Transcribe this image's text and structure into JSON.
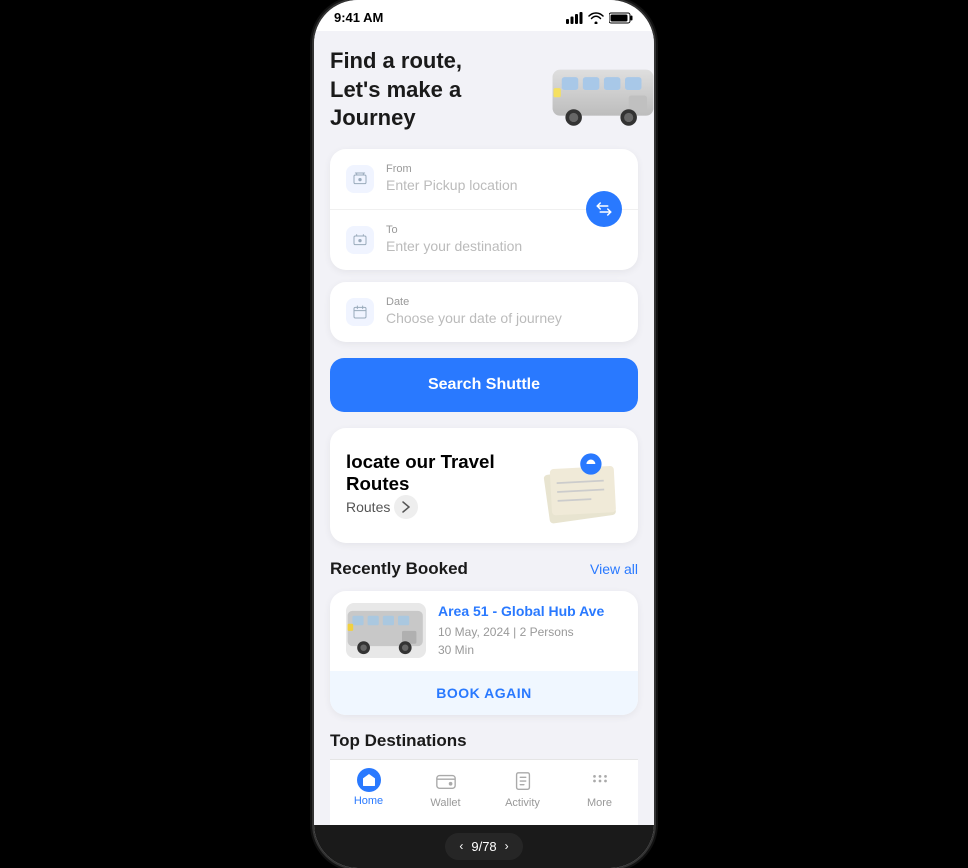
{
  "statusBar": {
    "time": "9:41 AM"
  },
  "hero": {
    "line1": "Find a route,",
    "line2": "Let's make a Journey"
  },
  "form": {
    "fromLabel": "From",
    "fromPlaceholder": "Enter Pickup location",
    "toLabel": "To",
    "toPlaceholder": "Enter your destination",
    "dateLabel": "Date",
    "datePlaceholder": "Choose your date of journey"
  },
  "searchButton": {
    "label": "Search Shuttle"
  },
  "routesCard": {
    "title": "locate our Travel Routes",
    "buttonLabel": "Routes"
  },
  "recentlyBooked": {
    "sectionTitle": "Recently Booked",
    "viewAllLabel": "View all",
    "booking": {
      "route": "Area 51 - Global Hub Ave",
      "date": "10 May, 2024 | 2 Persons",
      "duration": "30 Min"
    },
    "bookAgainLabel": "BOOK AGAIN"
  },
  "topDestinations": {
    "title": "Top Destinations"
  },
  "bottomNav": {
    "items": [
      {
        "label": "Home",
        "icon": "home-icon",
        "active": true
      },
      {
        "label": "Wallet",
        "icon": "wallet-icon",
        "active": false
      },
      {
        "label": "Activity",
        "icon": "activity-icon",
        "active": false
      },
      {
        "label": "More",
        "icon": "more-icon",
        "active": false
      }
    ]
  },
  "pagination": {
    "current": "9",
    "total": "78"
  }
}
